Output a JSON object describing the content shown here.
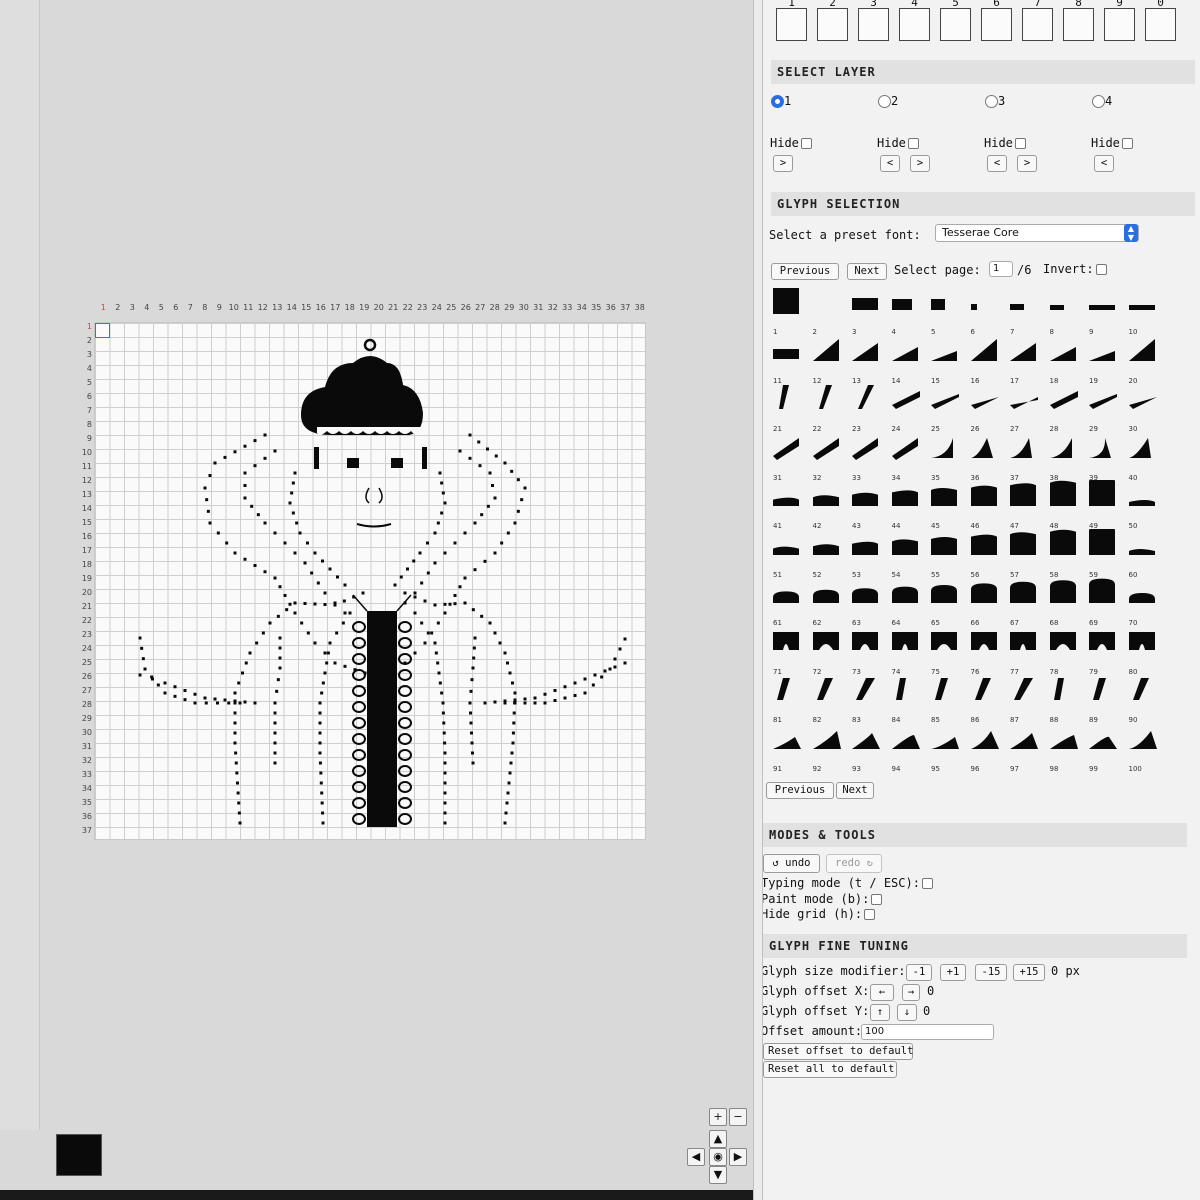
{
  "layer_slots": [
    "1",
    "2",
    "3",
    "4",
    "5",
    "6",
    "7",
    "8",
    "9",
    "0"
  ],
  "select_layer": {
    "title": "SELECT LAYER",
    "layers": [
      {
        "label": "1",
        "selected": true,
        "hide_label": "Hide",
        "nav": [
          ">"
        ]
      },
      {
        "label": "2",
        "selected": false,
        "hide_label": "Hide",
        "nav": [
          "<",
          ">"
        ]
      },
      {
        "label": "3",
        "selected": false,
        "hide_label": "Hide",
        "nav": [
          "<",
          ">"
        ]
      },
      {
        "label": "4",
        "selected": false,
        "hide_label": "Hide",
        "nav": [
          "<"
        ]
      }
    ]
  },
  "glyph_selection": {
    "title": "GLYPH SELECTION",
    "preset_label": "Select a preset font:",
    "preset_value": "Tesserae Core",
    "previous_label": "Previous",
    "next_label": "Next",
    "page_label": "Select page:",
    "page_value": "1",
    "page_total": "/6",
    "invert_label": "Invert:",
    "glyph_numbers": [
      "1",
      "2",
      "3",
      "4",
      "5",
      "6",
      "7",
      "8",
      "9",
      "10",
      "11",
      "12",
      "13",
      "14",
      "15",
      "16",
      "17",
      "18",
      "19",
      "20",
      "21",
      "22",
      "23",
      "24",
      "25",
      "26",
      "27",
      "28",
      "29",
      "30",
      "31",
      "32",
      "33",
      "34",
      "35",
      "36",
      "37",
      "38",
      "39",
      "40",
      "41",
      "42",
      "43",
      "44",
      "45",
      "46",
      "47",
      "48",
      "49",
      "50",
      "51",
      "52",
      "53",
      "54",
      "55",
      "56",
      "57",
      "58",
      "59",
      "60",
      "61",
      "62",
      "63",
      "64",
      "65",
      "66",
      "67",
      "68",
      "69",
      "70",
      "71",
      "72",
      "73",
      "74",
      "75",
      "76",
      "77",
      "78",
      "79",
      "80",
      "81",
      "82",
      "83",
      "84",
      "85",
      "86",
      "87",
      "88",
      "89",
      "90",
      "91",
      "92",
      "93",
      "94",
      "95",
      "96",
      "97",
      "98",
      "99",
      "100"
    ],
    "bottom_previous": "Previous",
    "bottom_next": "Next"
  },
  "modes_tools": {
    "title": "MODES & TOOLS",
    "undo": "undo",
    "redo": "redo",
    "typing_mode": "Typing mode (t / ESC):",
    "paint_mode": "Paint mode (b):",
    "hide_grid": "Hide grid (h):"
  },
  "fine_tuning": {
    "title": "GLYPH FINE TUNING",
    "size_label": "Glyph size modifier:",
    "size_buttons": [
      "-1",
      "+1",
      "-15",
      "+15"
    ],
    "size_value": "0 px",
    "offset_x_label": "Glyph offset X:",
    "offset_x_value": "0",
    "offset_y_label": "Glyph offset Y:",
    "offset_y_value": "0",
    "offset_amount_label": "Offset amount:",
    "offset_amount_value": "100",
    "reset_offset": "Reset offset to default",
    "reset_all": "Reset all to default"
  },
  "canvas": {
    "columns": [
      "1",
      "2",
      "3",
      "4",
      "5",
      "6",
      "7",
      "8",
      "9",
      "10",
      "11",
      "12",
      "13",
      "14",
      "15",
      "16",
      "17",
      "18",
      "19",
      "20",
      "21",
      "22",
      "23",
      "24",
      "25",
      "26",
      "27",
      "28",
      "29",
      "30",
      "31",
      "32",
      "33",
      "34",
      "35",
      "36",
      "37",
      "38"
    ],
    "rows": [
      "1",
      "2",
      "3",
      "4",
      "5",
      "6",
      "7",
      "8",
      "9",
      "10",
      "11",
      "12",
      "13",
      "14",
      "15",
      "16",
      "17",
      "18",
      "19",
      "20",
      "21",
      "22",
      "23",
      "24",
      "25",
      "26",
      "27",
      "28",
      "29",
      "30",
      "31",
      "32",
      "33",
      "34",
      "35",
      "36",
      "37"
    ]
  },
  "zoom": {
    "in": "+",
    "out": "−"
  },
  "nav_icons": [
    "arrow-up-icon",
    "arrow-left-icon",
    "center-icon",
    "arrow-right-icon",
    "arrow-down-icon"
  ],
  "colors": {
    "accent": "#2a6fe0",
    "cursor": "#d0443a",
    "ink": "#0a0a0a"
  }
}
